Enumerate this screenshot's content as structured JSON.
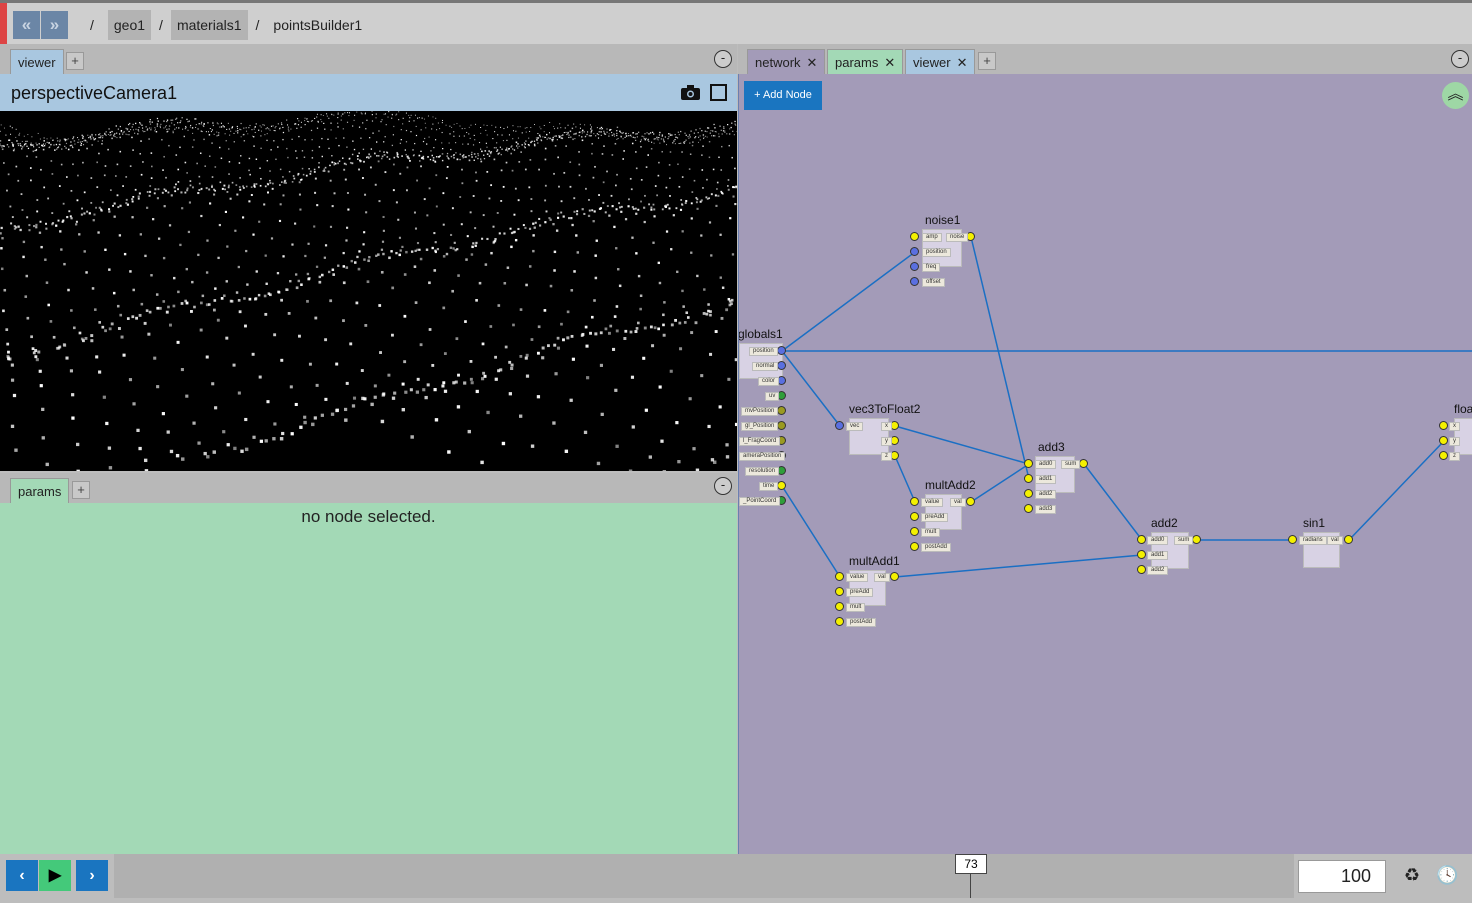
{
  "breadcrumb": {
    "root": "/",
    "items": [
      "geo1",
      "materials1",
      "pointsBuilder1"
    ],
    "separator": "/"
  },
  "nav": {
    "back_icon": "double-chevron-left-icon",
    "forward_icon": "double-chevron-right-icon",
    "back": "«",
    "forward": "»"
  },
  "left_top": {
    "tab": "viewer",
    "plus": "+",
    "minus": "-",
    "camera_name": "perspectiveCamera1"
  },
  "left_bottom": {
    "tab": "params",
    "plus": "+",
    "minus": "-",
    "message": "no node selected."
  },
  "right": {
    "tabs": [
      {
        "label": "network",
        "close": "✕"
      },
      {
        "label": "params",
        "close": "✕"
      },
      {
        "label": "viewer",
        "close": "✕"
      }
    ],
    "plus": "+",
    "minus": "-",
    "add_node": "+ Add Node",
    "collapse": "︽"
  },
  "nodes": {
    "noise1": {
      "title": "noise1",
      "inputs": [
        "amp",
        "position",
        "freq",
        "offset"
      ],
      "outputs": [
        "noise"
      ]
    },
    "globals1": {
      "title": "globals1",
      "outputs": [
        "position",
        "normal",
        "color",
        "uv",
        "mvPosition",
        "gl_Position",
        "gl_FragCoord",
        "cameraPosition",
        "resolution",
        "time",
        "gl_PointCoord"
      ],
      "visible_outputs": [
        "position",
        "normal",
        "color",
        "uv",
        "mvPosition",
        "gl_Position",
        "l_FragCoord",
        "ameraPosition",
        "resolution",
        "time",
        "_PointCoord"
      ]
    },
    "vec3ToFloat2": {
      "title": "vec3ToFloat2",
      "inputs": [
        "vec"
      ],
      "outputs": [
        "x",
        "y",
        "z"
      ]
    },
    "add3": {
      "title": "add3",
      "inputs": [
        "add0",
        "add1",
        "add2",
        "add3"
      ],
      "outputs": [
        "sum"
      ]
    },
    "multAdd2": {
      "title": "multAdd2",
      "inputs": [
        "value",
        "preAdd",
        "mult",
        "postAdd"
      ],
      "outputs": [
        "val"
      ]
    },
    "multAdd1": {
      "title": "multAdd1",
      "inputs": [
        "value",
        "preAdd",
        "mult",
        "postAdd"
      ],
      "outputs": [
        "val"
      ]
    },
    "add2": {
      "title": "add2",
      "inputs": [
        "add0",
        "add1",
        "add2"
      ],
      "outputs": [
        "sum"
      ]
    },
    "sin1": {
      "title": "sin1",
      "inputs": [
        "radians"
      ],
      "outputs": [
        "val"
      ]
    },
    "floatToVec": {
      "title": "floa",
      "inputs": [
        "x",
        "y",
        "z"
      ]
    }
  },
  "timeline": {
    "prev": "‹",
    "play": "▶",
    "next": "›",
    "current_frame": "73",
    "end_frame": "100",
    "recycle_icon": "recycle-icon",
    "clock_icon": "clock-icon"
  },
  "colors": {
    "vec_pin": "#5a6fe0",
    "float_pin": "#f4f000",
    "vec2_pin": "#2e9e3a",
    "vec4_pin": "#9a9a20",
    "wire": "#1a6fc4",
    "network_bg": "#a39bb8",
    "params_bg": "#a3d9b6",
    "camera_head": "#a9c7e0"
  }
}
